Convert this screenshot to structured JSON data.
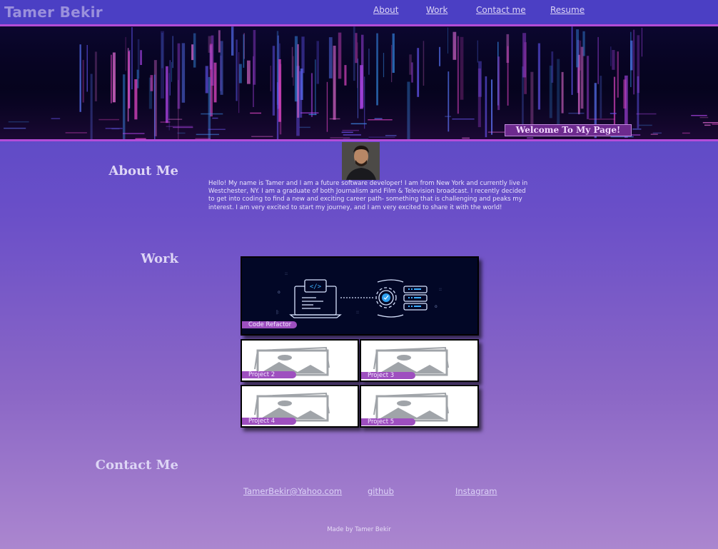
{
  "header": {
    "brand": "Tamer Bekir",
    "nav": [
      {
        "label": "About"
      },
      {
        "label": "Work"
      },
      {
        "label": "Contact me"
      },
      {
        "label": "Resume"
      }
    ]
  },
  "hero": {
    "welcome": "Welcome To My Page!"
  },
  "about": {
    "title": "About Me",
    "text": "Hello! My name is Tamer and I am a future software developer! I am from New York and currently live in Westchester, NY. I am a graduate of both Journalism and Film & Television broadcast. I recently decided to get into coding to find a new and exciting career path- something that is challenging and peaks my interest. I am very excited to start my journey, and I am very excited to share it with the world!"
  },
  "work": {
    "title": "Work",
    "projects": [
      {
        "label": "Code Refactor",
        "icon": "code-refactor-illustration"
      },
      {
        "label": "Project 2",
        "icon": "image-placeholder-icon"
      },
      {
        "label": "Project 3",
        "icon": "image-placeholder-icon"
      },
      {
        "label": "Project 4",
        "icon": "image-placeholder-icon"
      },
      {
        "label": "Project 5",
        "icon": "image-placeholder-icon"
      }
    ]
  },
  "contact": {
    "title": "Contact Me",
    "links": [
      {
        "label": "TamerBekir@Yahoo.com"
      },
      {
        "label": "github"
      },
      {
        "label": "Instagram"
      }
    ]
  },
  "footer": {
    "text": "Made by Tamer Bekir"
  }
}
